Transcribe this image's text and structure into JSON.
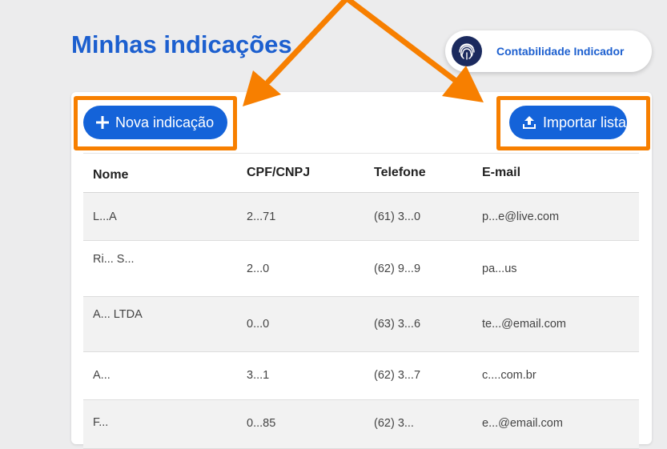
{
  "page": {
    "title": "Minhas indicações"
  },
  "account": {
    "name": "Contabilidade Indicador",
    "logo_icon": "fingerprint-icon"
  },
  "actions": {
    "new_label": "Nova indicação",
    "new_icon": "plus-icon",
    "import_label": "Importar lista",
    "import_icon": "upload-icon"
  },
  "table": {
    "headers": [
      "Nome",
      "CPF/CNPJ",
      "Telefone",
      "E-mail"
    ],
    "rows": [
      {
        "name": "L...A",
        "doc": "2...71",
        "phone": "(61) 3...0",
        "email": "p...e@live.com"
      },
      {
        "name": "Ri... S...",
        "doc": "2...0",
        "phone": "(62) 9...9",
        "email": "pa...us"
      },
      {
        "name": "A... LTDA",
        "doc": "0...0",
        "phone": "(63) 3...6",
        "email": "te...@email.com"
      },
      {
        "name": "A...",
        "doc": "3...1",
        "phone": "(62) 3...7",
        "email": "c....com.br"
      },
      {
        "name": "F...",
        "doc": "0...85",
        "phone": "(62) 3...",
        "email": "e...@email.com"
      }
    ]
  },
  "annotation": {
    "color": "#f77f00"
  },
  "colors": {
    "brand": "#1c5fcf",
    "button": "#1463d9"
  }
}
